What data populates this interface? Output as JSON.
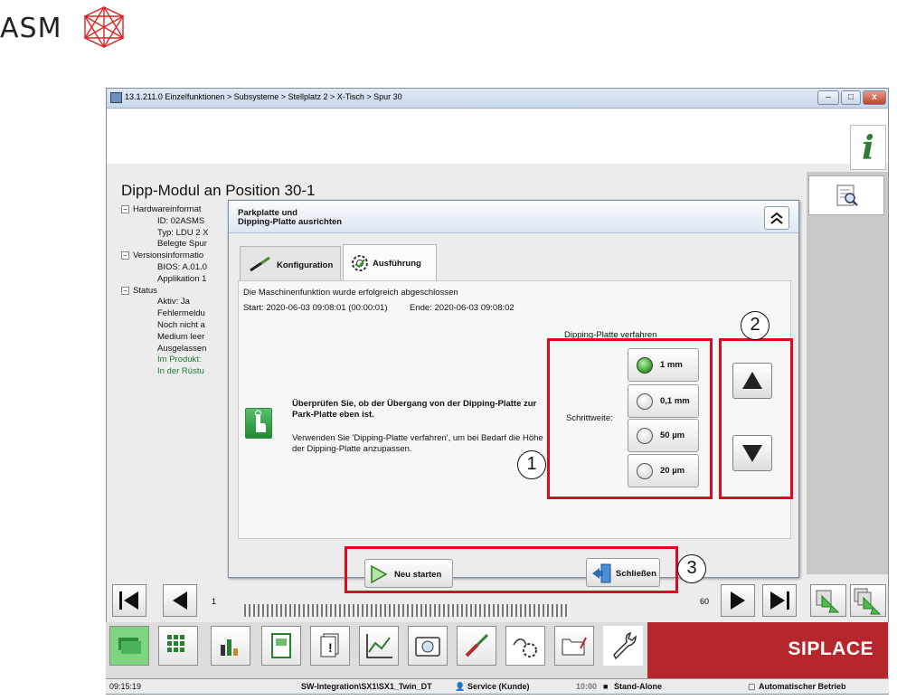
{
  "logo": {
    "text": "ASM"
  },
  "window": {
    "breadcrumb": "13.1.211.0 Einzelfunktionen > Subsysteme > Stellplatz 2 > X-Tisch > Spur 30",
    "min": "–",
    "max": "□",
    "close": "x"
  },
  "info_label": "i",
  "page_title": "Dipp-Modul an Position 30-1",
  "tree": [
    {
      "text": "Hardwareinformat",
      "indent": 0,
      "expander": "−",
      "color": "normal"
    },
    {
      "text": "ID: 02ASMS",
      "indent": 1,
      "color": "normal"
    },
    {
      "text": "Typ: LDU 2 X",
      "indent": 1,
      "color": "normal"
    },
    {
      "text": "Belegte Spur",
      "indent": 1,
      "color": "normal"
    },
    {
      "text": "Versionsinformatio",
      "indent": 0,
      "expander": "−",
      "color": "normal"
    },
    {
      "text": "BIOS: A.01.0",
      "indent": 1,
      "color": "normal"
    },
    {
      "text": "Applikation 1",
      "indent": 1,
      "color": "normal"
    },
    {
      "text": "Status",
      "indent": 0,
      "expander": "−",
      "color": "normal"
    },
    {
      "text": "Aktiv: Ja",
      "indent": 1,
      "color": "normal"
    },
    {
      "text": "Fehlermeldu",
      "indent": 1,
      "color": "normal"
    },
    {
      "text": "Noch nicht a",
      "indent": 1,
      "color": "normal"
    },
    {
      "text": "Medium leer",
      "indent": 1,
      "color": "normal"
    },
    {
      "text": "Ausgelassen",
      "indent": 1,
      "color": "normal"
    },
    {
      "text": "Im Produkt:",
      "indent": 1,
      "color": "green"
    },
    {
      "text": "In der Rüstu",
      "indent": 1,
      "color": "green"
    }
  ],
  "dialog": {
    "title_line1": "Parkplatte und",
    "title_line2": "Dipping-Platte ausrichten",
    "collapse": "˄",
    "tabs": [
      {
        "label": "Konfiguration",
        "active": false
      },
      {
        "label": "Ausführung",
        "active": true
      }
    ],
    "status_msg": "Die Maschinenfunktion wurde erfolgreich abgeschlossen",
    "start": "Start: 2020-06-03 09:08:01 (00:00:01)",
    "end": "Ende: 2020-06-03 09:08:02",
    "instruction_bold": "Überprüfen Sie, ob der Übergang von der Dipping-Platte zur Park-Platte eben ist.",
    "instruction_normal": "Verwenden Sie 'Dipping-Platte verfahren', um bei Bedarf die Höhe der Dipping-Platte anzupassen.",
    "group_label": "Dipping-Platte verfahren",
    "schrittweite_label": "Schrittweite:",
    "steps": [
      {
        "label": "1 mm",
        "selected": true
      },
      {
        "label": "0,1 mm",
        "selected": false
      },
      {
        "label": "50 µm",
        "selected": false
      },
      {
        "label": "20 µm",
        "selected": false
      }
    ],
    "restart_label": "Neu starten",
    "close_label": "Schließen"
  },
  "callouts": [
    "1",
    "2",
    "3"
  ],
  "nav": {
    "page_left": "1",
    "page_right": "60"
  },
  "brand": "SIPLACE",
  "statusbar": {
    "time": "09:15:19",
    "path": "SW-Integration\\SX1\\SX1_Twin_DT",
    "role": "Service (Kunde)",
    "time2": "10:00",
    "mode": "Stand-Alone",
    "state": "Automatischer Betrieb"
  },
  "colors": {
    "highlight_red": "#e2061f",
    "brand_red": "#b5272d",
    "green_text": "#1d7c2e"
  }
}
